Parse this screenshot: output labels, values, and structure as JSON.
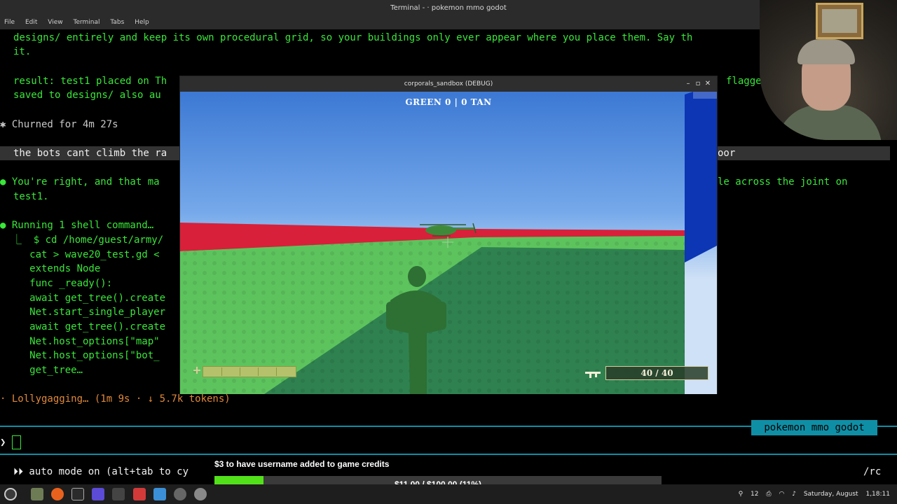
{
  "terminal": {
    "window_title": "Terminal - · pokemon mmo godot",
    "menu": [
      "File",
      "Edit",
      "View",
      "Terminal",
      "Tabs",
      "Help"
    ],
    "line1": "designs/ entirely and keep its own procedural grid, so your buildings only ever appear where you place them. Say th",
    "line2": "it.",
    "line3": "result: test1 placed on Th",
    "line3b": "flagge",
    "line4": "saved to designs/ also au",
    "churned": "✱ Churned for 4m 27s",
    "user_msg": "the bots cant climb the ra",
    "user_msg_tail": "oor",
    "reply_a": "● You're right, and that ma",
    "reply_a_tail": "le across the joint on",
    "reply_b": "test1.",
    "running": "● Running 1 shell command…",
    "cmd_lines": [
      "  ⎿  $ cd /home/guest/army/",
      "     cat > wave20_test.gd <",
      "     extends Node",
      "     func _ready():",
      "     await get_tree().create",
      "     Net.start_single_player",
      "     await get_tree().create",
      "     Net.host_options[\"map\"",
      "     Net.host_options[\"bot_",
      "     get_tree…"
    ],
    "status": "· Lollygagging… (1m 9s · ↓ 5.7k tokens)",
    "project_badge": "pokemon mmo godot",
    "prompt_symbol": "❯",
    "auto_mode": "⏵⏵ auto mode on (alt+tab to cy",
    "rc": "/rc"
  },
  "game": {
    "window_title": "corporals_sandbox (DEBUG)",
    "score_text": "GREEN 0  |  0 TAN",
    "ammo_text": "40 / 40",
    "health_fraction": 1.0,
    "colors": {
      "sky": "#3c79d4",
      "ground": "#5dc45d",
      "wall_red": "#d8203a",
      "wall_blue": "#0c36b4",
      "soldier": "#2e6f34"
    }
  },
  "donation": {
    "title": "$3 to have username added to game credits",
    "progress_text": "$11.00 / $100.00 (11%)",
    "progress_fraction": 0.11
  },
  "taskbar": {
    "date": "Saturday, August",
    "time": "1,18:11",
    "tray_count": "12"
  }
}
